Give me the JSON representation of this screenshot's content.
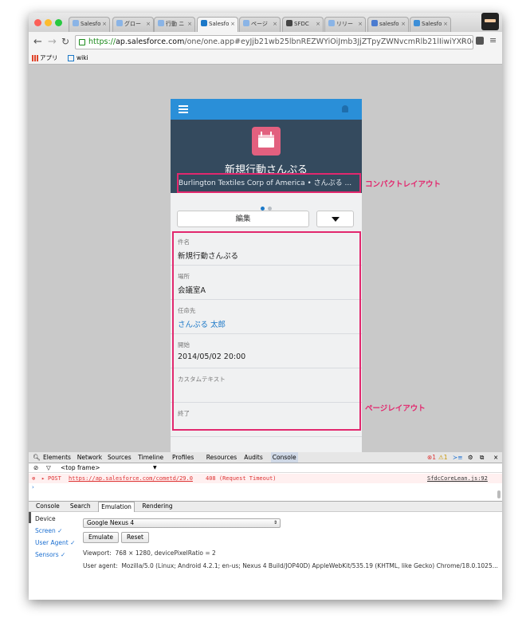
{
  "browser": {
    "tabs": [
      {
        "label": "Salesfo",
        "color": "#8ab4e6"
      },
      {
        "label": "グロー",
        "color": "#8ab4e6"
      },
      {
        "label": "行動 ニ",
        "color": "#8ab4e6"
      },
      {
        "label": "Salesfo",
        "color": "#1b78c8"
      },
      {
        "label": "ページ",
        "color": "#8ab4e6"
      },
      {
        "label": "SFDC",
        "color": "#444444"
      },
      {
        "label": "リリー",
        "color": "#8ab4e6"
      },
      {
        "label": "salesfo",
        "color": "#4a7bd0"
      },
      {
        "label": "Salesfo",
        "color": "#3d8fd8"
      }
    ],
    "active_tab": 3,
    "url_scheme": "https://",
    "url_host": "ap.salesforce.com",
    "url_rest": "/one/one.app#eyJjb21wb25lbnREZWYiOiJmb3JjZTpyZWNvcmRlb21lIiwiYXR0cmlid...",
    "bookmarks": [
      {
        "label": "アプリ",
        "icon": "apps-grid-icon"
      },
      {
        "label": "wiki",
        "icon": "page-icon"
      }
    ]
  },
  "record": {
    "title": "新規行動さんぷる",
    "subtitle": "Burlington Textiles Corp of America • さんぷる ...",
    "edit_label": "編集",
    "fields": [
      {
        "label": "件名",
        "value": "新規行動さんぷる",
        "link": false
      },
      {
        "label": "場所",
        "value": "会議室A",
        "link": false
      },
      {
        "label": "任命先",
        "value": "さんぷる 太郎",
        "link": true
      },
      {
        "label": "開始",
        "value": "2014/05/02 20:00",
        "link": false
      },
      {
        "label": "カスタムテキスト",
        "value": "",
        "link": false
      },
      {
        "label": "終了",
        "value": "",
        "link": false
      }
    ]
  },
  "annotations": {
    "compact": "コンパクトレイアウト",
    "page": "ページレイアウト",
    "color": "#e2286e"
  },
  "devtools": {
    "panels": [
      "Elements",
      "Network",
      "Sources",
      "Timeline",
      "Profiles",
      "Resources",
      "Audits",
      "Console"
    ],
    "active_panel": "Console",
    "counts": {
      "errors": "1",
      "warnings": "1"
    },
    "frame": "<top frame>",
    "error": {
      "method": "POST",
      "url": "https://ap.salesforce.com/cometd/29.0",
      "status": "408 (Request Timeout)",
      "source": "SfdcCoreLean.js:92"
    },
    "drawer_tabs": [
      "Console",
      "Search",
      "Emulation",
      "Rendering"
    ],
    "active_drawer_tab": "Emulation",
    "emulation": {
      "sidebar": [
        "Device",
        "Screen ✓",
        "User Agent ✓",
        "Sensors ✓"
      ],
      "device": "Google Nexus 4",
      "emulate_label": "Emulate",
      "reset_label": "Reset",
      "viewport_label": "Viewport:",
      "viewport_value": "768 × 1280, devicePixelRatio = 2",
      "ua_label": "User agent:",
      "ua_value": "Mozilla/5.0 (Linux; Android 4.2.1; en-us; Nexus 4 Build/JOP40D) AppleWebKit/535.19 (KHTML, like Gecko) Chrome/18.0.1025..."
    }
  }
}
